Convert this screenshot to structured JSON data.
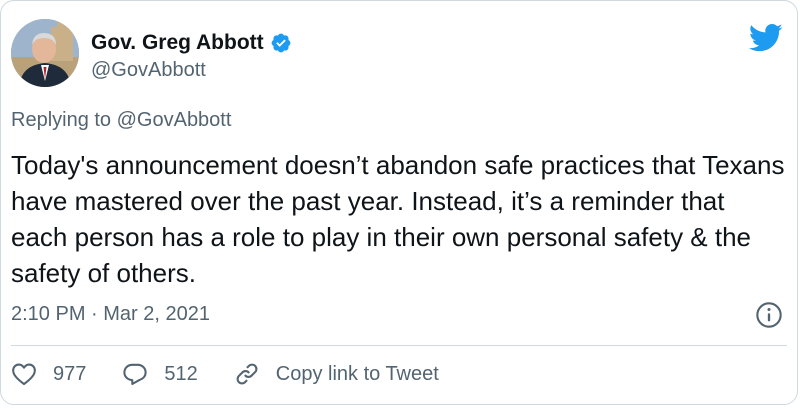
{
  "author": {
    "display_name": "Gov. Greg Abbott",
    "handle": "@GovAbbott",
    "verified": true
  },
  "reply": {
    "label": "Replying to @GovAbbott"
  },
  "tweet": {
    "text": "Today's announcement doesn’t abandon safe practices that Texans have mastered over the past year. Instead, it’s a reminder that each person has a role to play in their own personal safety & the safety of others.",
    "timestamp": "2:10 PM · Mar 2, 2021"
  },
  "actions": {
    "likes": "977",
    "replies": "512",
    "copy_link_label": "Copy link to Tweet"
  },
  "icons": {
    "brand": "twitter-bird-icon",
    "verified": "verified-badge-icon",
    "info": "info-icon",
    "like": "heart-icon",
    "reply": "reply-bubble-icon",
    "link": "link-icon"
  },
  "colors": {
    "twitter_blue": "#1d9bf0",
    "text_primary": "#0f1419",
    "text_secondary": "#536471",
    "border": "#cfd9de"
  }
}
